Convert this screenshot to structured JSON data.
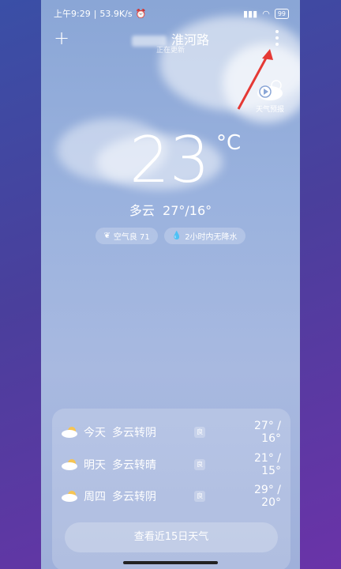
{
  "status": {
    "time": "上午9:29",
    "network_speed": "53.9K/s",
    "battery": "99"
  },
  "header": {
    "location": "淮河路",
    "subtitle": "正在更新"
  },
  "forecast_button": {
    "label": "天气预报"
  },
  "current": {
    "temperature": "23",
    "unit": "°C",
    "condition": "多云",
    "range": "27°/16°"
  },
  "chips": [
    {
      "icon": "leaf-icon",
      "label": "空气良 71"
    },
    {
      "icon": "drop-icon",
      "label": "2小时内无降水"
    }
  ],
  "daily": [
    {
      "day": "今天",
      "desc": "多云转阴",
      "aqi": "良",
      "range": "27° / 16°"
    },
    {
      "day": "明天",
      "desc": "多云转晴",
      "aqi": "良",
      "range": "21° / 15°"
    },
    {
      "day": "周四",
      "desc": "多云转阴",
      "aqi": "良",
      "range": "29° / 20°"
    }
  ],
  "more_button": {
    "label": "查看近15日天气"
  }
}
